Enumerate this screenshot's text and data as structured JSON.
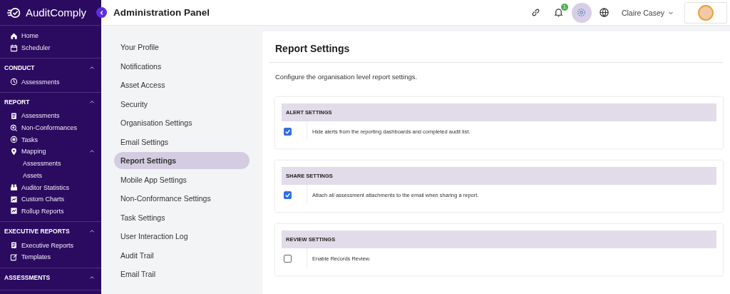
{
  "brand": "AuditComply",
  "header": {
    "title": "Administration Panel",
    "notification_count": "1",
    "user_name": "Claire Casey",
    "tools": [
      {
        "kind": "link",
        "selected": false
      },
      {
        "kind": "bell",
        "selected": false
      },
      {
        "kind": "gear",
        "selected": true
      },
      {
        "kind": "globe",
        "selected": false
      }
    ]
  },
  "sidebar": {
    "sections": [
      {
        "items": [
          {
            "label": "Home"
          },
          {
            "label": "Scheduler"
          }
        ]
      },
      {
        "title": "CONDUCT",
        "expanded": true,
        "items": [
          {
            "label": "Assessments"
          }
        ]
      },
      {
        "title": "REPORT",
        "expanded": true,
        "items": [
          {
            "label": "Assessments"
          },
          {
            "label": "Non-Conformances"
          },
          {
            "label": "Tasks"
          },
          {
            "label": "Mapping",
            "expanded": true,
            "children": [
              {
                "label": "Assessments"
              },
              {
                "label": "Assets"
              }
            ]
          },
          {
            "label": "Auditor Statistics"
          },
          {
            "label": "Custom Charts"
          },
          {
            "label": "Rollup Reports"
          }
        ]
      },
      {
        "title": "EXECUTIVE REPORTS",
        "expanded": true,
        "items": [
          {
            "label": "Executive Reports"
          },
          {
            "label": "Templates"
          }
        ]
      },
      {
        "title": "ASSESSMENTS",
        "expanded": true
      }
    ]
  },
  "admin_nav": [
    {
      "label": "Your Profile",
      "selected": false
    },
    {
      "label": "Notifications",
      "selected": false
    },
    {
      "label": "Asset Access",
      "selected": false
    },
    {
      "label": "Security",
      "selected": false
    },
    {
      "label": "Organisation Settings",
      "selected": false
    },
    {
      "label": "Email Settings",
      "selected": false
    },
    {
      "label": "Report Settings",
      "selected": true
    },
    {
      "label": "Mobile App Settings",
      "selected": false
    },
    {
      "label": "Non-Conformance Settings",
      "selected": false
    },
    {
      "label": "Task Settings",
      "selected": false
    },
    {
      "label": "User Interaction Log",
      "selected": false
    },
    {
      "label": "Audit Trail",
      "selected": false
    },
    {
      "label": "Email Trail",
      "selected": false
    }
  ],
  "content": {
    "title": "Report Settings",
    "description": "Configure the organisation level report settings.",
    "cards": [
      {
        "title": "ALERT SETTINGS",
        "options": [
          {
            "label": "Hide alerts from the reporting dashboards and completed audit list.",
            "checked": true
          }
        ]
      },
      {
        "title": "SHARE SETTINGS",
        "options": [
          {
            "label": "Attach all assessment attachments to the email when sharing a report.",
            "checked": true
          }
        ]
      },
      {
        "title": "REVIEW SETTINGS",
        "options": [
          {
            "label": "Enable Records Review.",
            "checked": false
          }
        ]
      }
    ]
  }
}
